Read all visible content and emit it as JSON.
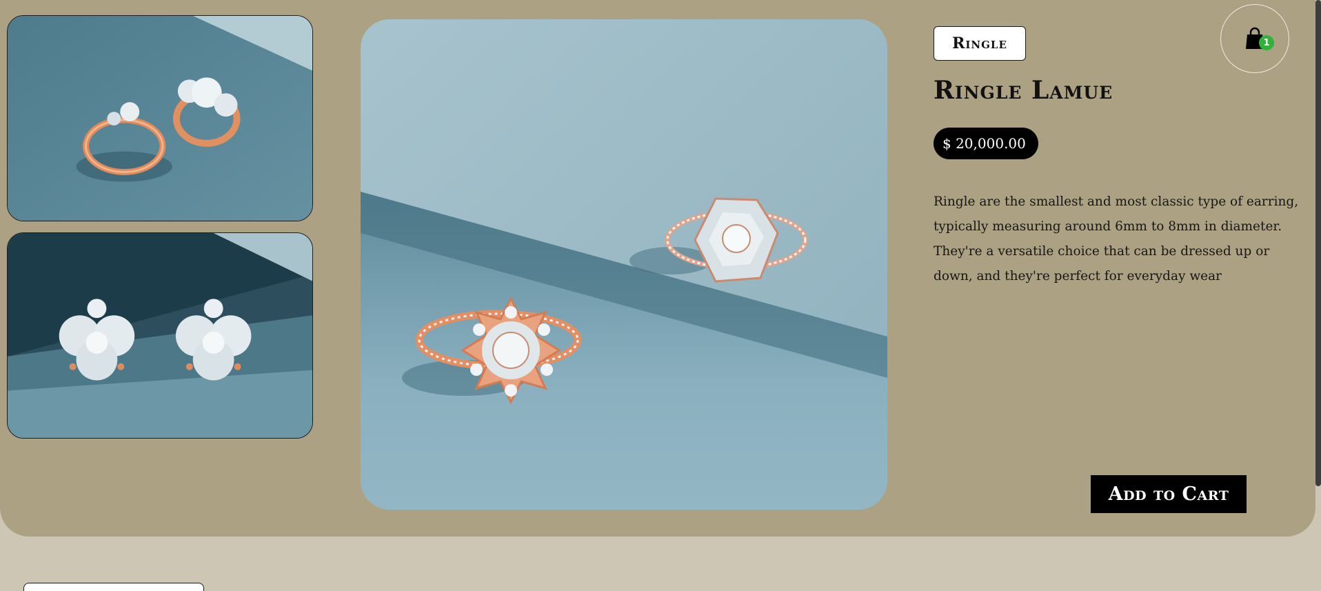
{
  "product": {
    "category": "Ringle",
    "title": "Ringle Lamue",
    "price": "$ 20,000.00",
    "description": "Ringle are the smallest and most classic type of earring, typically measuring around 6mm to 8mm in diameter. They're a versatile choice that can be dressed up or down, and they're perfect for everyday wear"
  },
  "actions": {
    "add_to_cart_label": "Add to Cart"
  },
  "cart": {
    "count": "1",
    "icon": "shopping-bag-icon",
    "badge_color": "#2fb33a"
  },
  "gallery": {
    "thumbnails": [
      "rose-gold-two-rings-photo",
      "diamond-earrings-photo"
    ],
    "main": "two-diamond-rings-photo"
  },
  "colors": {
    "hero_background": "#aca283",
    "page_background": "#cec6b4",
    "accent": "#000000"
  }
}
